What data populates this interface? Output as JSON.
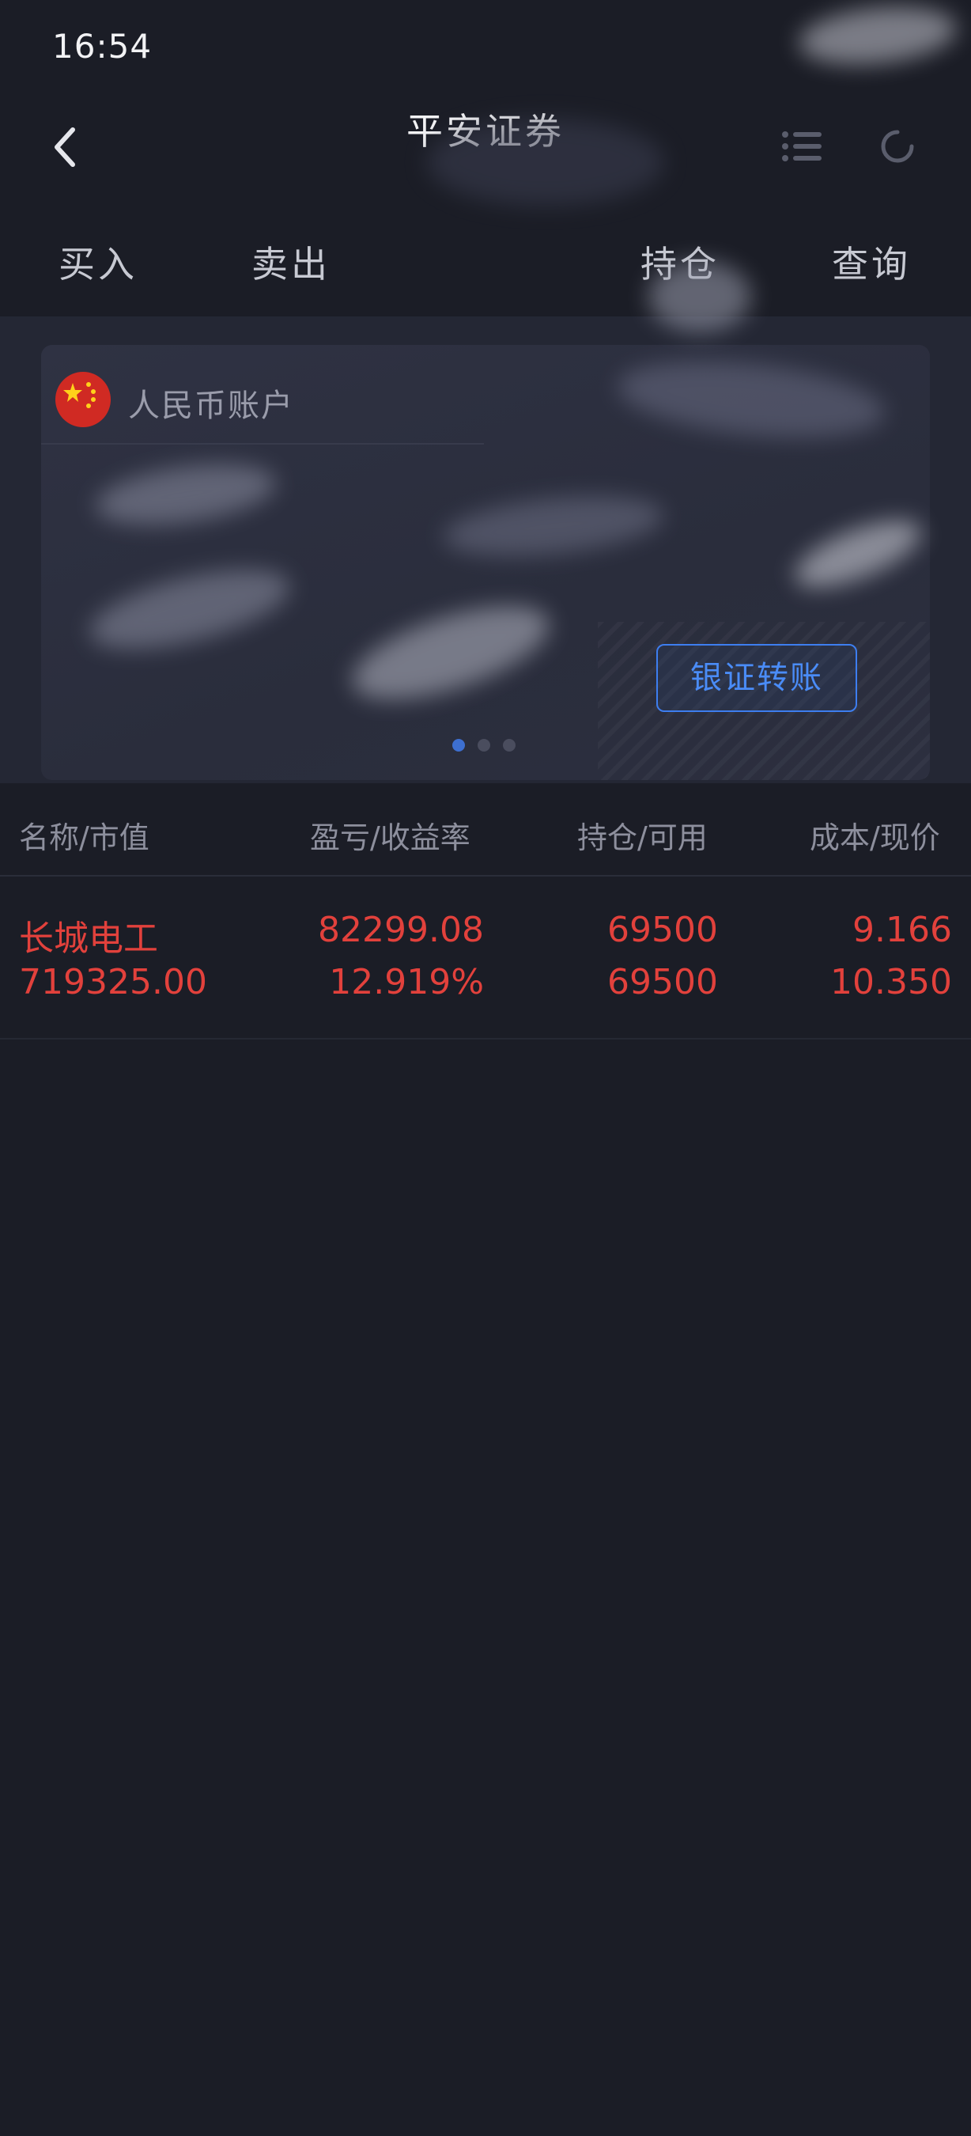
{
  "status_bar": {
    "time": "16:54"
  },
  "header": {
    "title": "平安证券"
  },
  "tabs": [
    "买入",
    "卖出",
    "持仓",
    "查询"
  ],
  "account_card": {
    "account_label": "人民币账户",
    "transfer_button": "银证转账",
    "page_dots": 3,
    "active_dot": 0
  },
  "table": {
    "columns": [
      "名称/市值",
      "盈亏/收益率",
      "持仓/可用",
      "成本/现价"
    ],
    "rows": [
      {
        "name": "长城电工",
        "market_value": "719325.00",
        "profit_loss": "82299.08",
        "return_rate": "12.919%",
        "position": "69500",
        "available": "69500",
        "cost": "9.166",
        "current_price": "10.350"
      }
    ]
  },
  "colors": {
    "background": "#1b1d26",
    "gain_red": "#e2413c",
    "accent_blue": "#3d7ef0",
    "header_text": "#8d8f9d"
  }
}
